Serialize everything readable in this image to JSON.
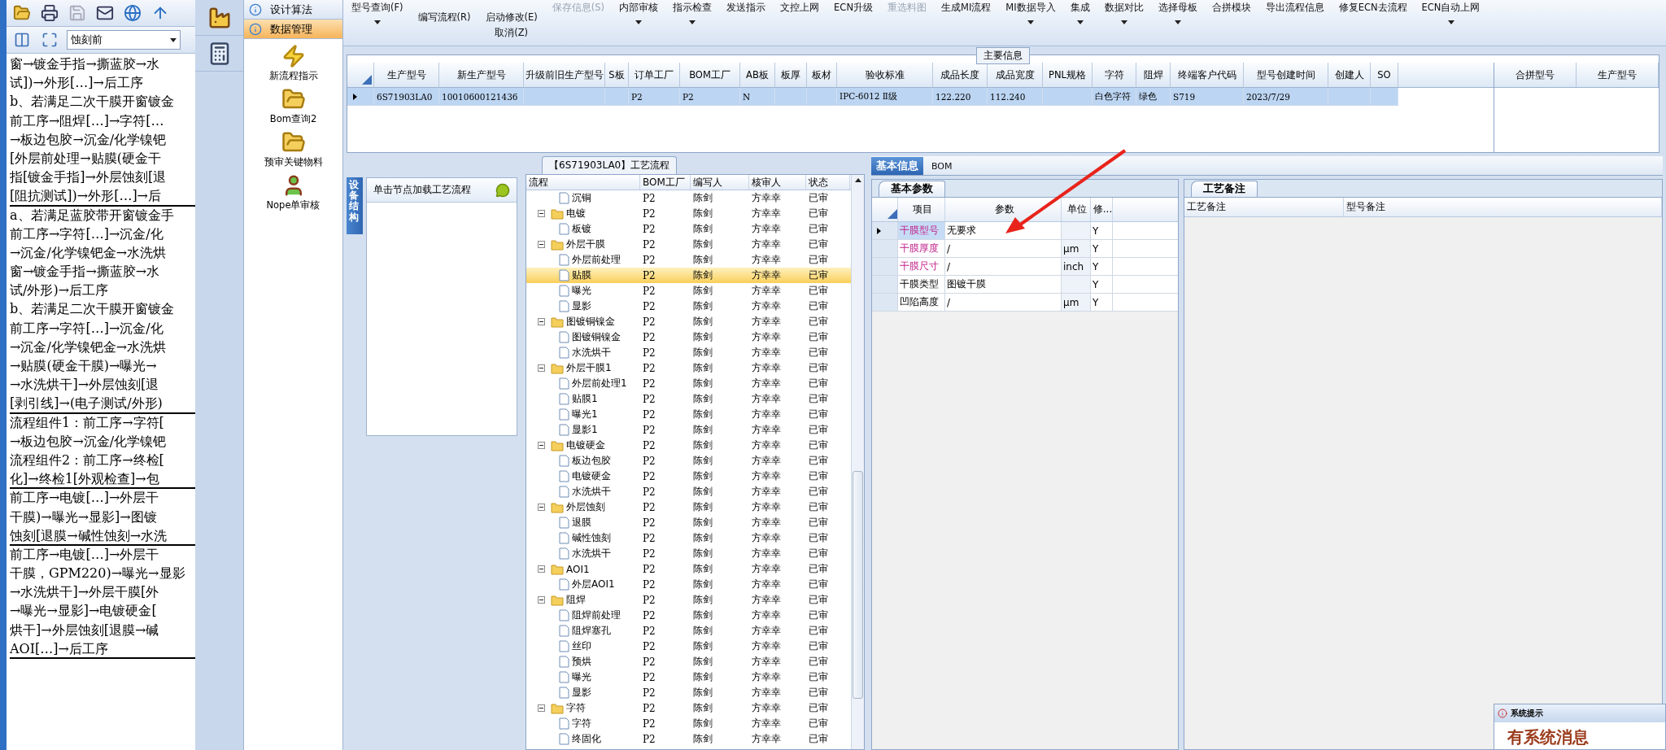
{
  "left_panel": {
    "combo_value": "蚀刻前",
    "lines": [
      {
        "text": "窗→镀金手指→撕蓝胶→水",
        "rule_below": false
      },
      {
        "text": "试])→外形[…]→后工序",
        "rule_below": false
      },
      {
        "text": "b、若满足二次干膜开窗镀金",
        "rule_below": false
      },
      {
        "text": "前工序→阻焊[…]→字符[…",
        "rule_below": false
      },
      {
        "text": "→板边包胶→沉金/化学镍钯",
        "rule_below": false
      },
      {
        "text": "[外层前处理→贴膜(硬金干",
        "rule_below": false
      },
      {
        "text": "指[镀金手指]→外层蚀刻[退",
        "rule_below": false
      },
      {
        "text": "[阻抗测试])→外形[…]→后",
        "rule_below": true
      },
      {
        "text": "a、若满足蓝胶带开窗镀金手",
        "rule_below": false
      },
      {
        "text": "前工序→字符[…]→沉金/化",
        "rule_below": false
      },
      {
        "text": "→沉金/化学镍钯金→水洗烘",
        "rule_below": false
      },
      {
        "text": "窗→镀金手指→撕蓝胶→水",
        "rule_below": false
      },
      {
        "text": "试/外形)→后工序",
        "rule_below": false
      },
      {
        "text": "b、若满足二次干膜开窗镀金",
        "rule_below": false
      },
      {
        "text": "前工序→字符[…]→沉金/化",
        "rule_below": false
      },
      {
        "text": "→沉金/化学镍钯金→水洗烘",
        "rule_below": false
      },
      {
        "text": "→贴膜(硬金干膜)→曝光→",
        "rule_below": false
      },
      {
        "text": "→水洗烘干]→外层蚀刻[退",
        "rule_below": false
      },
      {
        "text": "[剥引线]→(电子测试/外形)",
        "rule_below": true
      },
      {
        "text": "流程组件1：前工序→字符[",
        "rule_below": false
      },
      {
        "text": "→板边包胶→沉金/化学镍钯",
        "rule_below": false
      },
      {
        "text": "流程组件2：前工序→终检[",
        "rule_below": false
      },
      {
        "text": "化]→终检1[外观检查]→包",
        "rule_below": true
      },
      {
        "text": "前工序→电镀[…]→外层干",
        "rule_below": false
      },
      {
        "text": "干膜)→曝光→显影]→图镀",
        "rule_below": false
      },
      {
        "text": "蚀刻[退膜→碱性蚀刻→水洗",
        "rule_below": true
      },
      {
        "text": "前工序→电镀[…]→外层干",
        "rule_below": false
      },
      {
        "text": "干膜，GPM220)→曝光→显影",
        "rule_below": false
      },
      {
        "text": "→水洗烘干]→外层干膜[外",
        "rule_below": false
      },
      {
        "text": "→曝光→显影]→电镀硬金[",
        "rule_below": false
      },
      {
        "text": "烘干]→外层蚀刻[退膜→碱",
        "rule_below": false
      },
      {
        "text": "AOI[…]→后工序",
        "rule_below": true
      }
    ]
  },
  "nav": {
    "sections": [
      {
        "label": "设计算法",
        "selected": false
      },
      {
        "label": "数据管理",
        "selected": true
      }
    ],
    "items": [
      {
        "label": "新流程指示",
        "kind": "bolt"
      },
      {
        "label": "Bom查询2",
        "kind": "folder"
      },
      {
        "label": "预审关键物料",
        "kind": "folder"
      },
      {
        "label": "Nope单审核",
        "kind": "person"
      }
    ]
  },
  "toolbar": {
    "items": [
      {
        "label": "型号查询(F)",
        "menu": true,
        "disabled": false
      },
      {
        "stack": [
          {
            "label": "编写流程(R)",
            "disabled": false
          }
        ]
      },
      {
        "stack": [
          {
            "label": "启动修改(E)",
            "disabled": false
          },
          {
            "label": "取消(Z)",
            "disabled": false
          }
        ]
      },
      {
        "label": "保存信息(S)",
        "menu": false,
        "disabled": true
      },
      {
        "label": "内部审核",
        "menu": true,
        "disabled": false
      },
      {
        "label": "指示检查",
        "menu": true,
        "disabled": false
      },
      {
        "label": "发送指示",
        "menu": false,
        "disabled": false
      },
      {
        "label": "文控上网",
        "menu": false,
        "disabled": false
      },
      {
        "label": "ECN升级",
        "menu": false,
        "disabled": false
      },
      {
        "label": "重选料图",
        "menu": false,
        "disabled": true
      },
      {
        "label": "生成MI流程",
        "menu": false,
        "disabled": false
      },
      {
        "label": "MI数据导入",
        "menu": true,
        "disabled": false
      },
      {
        "label": "集成",
        "menu": true,
        "disabled": false
      },
      {
        "label": "数据对比",
        "menu": true,
        "disabled": false
      },
      {
        "label": "选择母板",
        "menu": true,
        "disabled": false
      },
      {
        "label": "合拼模块",
        "menu": false,
        "disabled": false
      },
      {
        "label": "导出流程信息",
        "menu": false,
        "disabled": false
      },
      {
        "label": "修复ECN去流程",
        "menu": false,
        "disabled": false
      },
      {
        "label": "ECN自动上网",
        "menu": true,
        "disabled": false
      }
    ]
  },
  "main_info": {
    "title": "主要信息",
    "columns": [
      "生产型号",
      "新生产型号",
      "升级前旧生产型号",
      "S板",
      "订单工厂",
      "BOM工厂",
      "AB板",
      "板厚",
      "板材",
      "验收标准",
      "成品长度",
      "成品宽度",
      "PNL规格",
      "字符",
      "阻焊",
      "终端客户代码",
      "型号创建时间",
      "创建人",
      "SO"
    ],
    "rows": [
      {
        "selected": true,
        "cells": {
          "0": "6S71903LA0",
          "1": "10010600121436",
          "4": "P2",
          "5": "P2",
          "6": "N",
          "9": "IPC-6012 Ⅱ级",
          "10": "122.220",
          "11": "112.240",
          "13": "白色字符",
          "14": "绿色",
          "15": "S719",
          "16": "2023/7/29"
        }
      }
    ],
    "side_columns": [
      "合拼型号",
      "生产型号"
    ]
  },
  "equipment_panel": {
    "tab": "设备结构",
    "hint": "单击节点加载工艺流程"
  },
  "process_tree": {
    "title": "【6S71903LA0】工艺流程",
    "columns": [
      "流程",
      "BOM工厂",
      "编写人",
      "核审人",
      "状态"
    ],
    "nodes": [
      {
        "kind": "file",
        "label": "沉铜",
        "bom": "P2",
        "writer": "陈剑",
        "reviewer": "方幸幸",
        "status": "已审",
        "selected": false
      },
      {
        "kind": "folder",
        "label": "电镀",
        "bom": "P2",
        "writer": "陈剑",
        "reviewer": "方幸幸",
        "status": "已审",
        "selected": false,
        "expanded": true,
        "children": [
          {
            "kind": "file",
            "label": "板镀",
            "bom": "P2",
            "writer": "陈剑",
            "reviewer": "方幸幸",
            "status": "已审",
            "selected": false
          }
        ]
      },
      {
        "kind": "folder",
        "label": "外层干膜",
        "bom": "P2",
        "writer": "陈剑",
        "reviewer": "方幸幸",
        "status": "已审",
        "selected": false,
        "expanded": true,
        "children": [
          {
            "kind": "file",
            "label": "外层前处理",
            "bom": "P2",
            "writer": "陈剑",
            "reviewer": "方幸幸",
            "status": "已审",
            "selected": false
          },
          {
            "kind": "file",
            "label": "贴膜",
            "bom": "P2",
            "writer": "陈剑",
            "reviewer": "方幸幸",
            "status": "已审",
            "selected": true
          },
          {
            "kind": "file",
            "label": "曝光",
            "bom": "P2",
            "writer": "陈剑",
            "reviewer": "方幸幸",
            "status": "已审",
            "selected": false
          },
          {
            "kind": "file",
            "label": "显影",
            "bom": "P2",
            "writer": "陈剑",
            "reviewer": "方幸幸",
            "status": "已审",
            "selected": false
          }
        ]
      },
      {
        "kind": "folder",
        "label": "图镀铜镍金",
        "bom": "P2",
        "writer": "陈剑",
        "reviewer": "方幸幸",
        "status": "已审",
        "selected": false,
        "expanded": true,
        "children": [
          {
            "kind": "file",
            "label": "图镀铜镍金",
            "bom": "P2",
            "writer": "陈剑",
            "reviewer": "方幸幸",
            "status": "已审",
            "selected": false
          },
          {
            "kind": "file",
            "label": "水洗烘干",
            "bom": "P2",
            "writer": "陈剑",
            "reviewer": "方幸幸",
            "status": "已审",
            "selected": false
          }
        ]
      },
      {
        "kind": "folder",
        "label": "外层干膜1",
        "bom": "P2",
        "writer": "陈剑",
        "reviewer": "方幸幸",
        "status": "已审",
        "selected": false,
        "expanded": true,
        "children": [
          {
            "kind": "file",
            "label": "外层前处理1",
            "bom": "P2",
            "writer": "陈剑",
            "reviewer": "方幸幸",
            "status": "已审",
            "selected": false
          },
          {
            "kind": "file",
            "label": "贴膜1",
            "bom": "P2",
            "writer": "陈剑",
            "reviewer": "方幸幸",
            "status": "已审",
            "selected": false
          },
          {
            "kind": "file",
            "label": "曝光1",
            "bom": "P2",
            "writer": "陈剑",
            "reviewer": "方幸幸",
            "status": "已审",
            "selected": false
          },
          {
            "kind": "file",
            "label": "显影1",
            "bom": "P2",
            "writer": "陈剑",
            "reviewer": "方幸幸",
            "status": "已审",
            "selected": false
          }
        ]
      },
      {
        "kind": "folder",
        "label": "电镀硬金",
        "bom": "P2",
        "writer": "陈剑",
        "reviewer": "方幸幸",
        "status": "已审",
        "selected": false,
        "expanded": true,
        "children": [
          {
            "kind": "file",
            "label": "板边包胶",
            "bom": "P2",
            "writer": "陈剑",
            "reviewer": "方幸幸",
            "status": "已审",
            "selected": false
          },
          {
            "kind": "file",
            "label": "电镀硬金",
            "bom": "P2",
            "writer": "陈剑",
            "reviewer": "方幸幸",
            "status": "已审",
            "selected": false
          },
          {
            "kind": "file",
            "label": "水洗烘干",
            "bom": "P2",
            "writer": "陈剑",
            "reviewer": "方幸幸",
            "status": "已审",
            "selected": false
          }
        ]
      },
      {
        "kind": "folder",
        "label": "外层蚀刻",
        "bom": "P2",
        "writer": "陈剑",
        "reviewer": "方幸幸",
        "status": "已审",
        "selected": false,
        "expanded": true,
        "children": [
          {
            "kind": "file",
            "label": "退膜",
            "bom": "P2",
            "writer": "陈剑",
            "reviewer": "方幸幸",
            "status": "已审",
            "selected": false
          },
          {
            "kind": "file",
            "label": "碱性蚀刻",
            "bom": "P2",
            "writer": "陈剑",
            "reviewer": "方幸幸",
            "status": "已审",
            "selected": false
          },
          {
            "kind": "file",
            "label": "水洗烘干",
            "bom": "P2",
            "writer": "陈剑",
            "reviewer": "方幸幸",
            "status": "已审",
            "selected": false
          }
        ]
      },
      {
        "kind": "folder",
        "label": "AOI1",
        "bom": "P2",
        "writer": "陈剑",
        "reviewer": "方幸幸",
        "status": "已审",
        "selected": false,
        "expanded": true,
        "children": [
          {
            "kind": "file",
            "label": "外层AOI1",
            "bom": "P2",
            "writer": "陈剑",
            "reviewer": "方幸幸",
            "status": "已审",
            "selected": false
          }
        ]
      },
      {
        "kind": "folder",
        "label": "阻焊",
        "bom": "P2",
        "writer": "陈剑",
        "reviewer": "方幸幸",
        "status": "已审",
        "selected": false,
        "expanded": true,
        "children": [
          {
            "kind": "file",
            "label": "阻焊前处理",
            "bom": "P2",
            "writer": "陈剑",
            "reviewer": "方幸幸",
            "status": "已审",
            "selected": false
          },
          {
            "kind": "file",
            "label": "阻焊塞孔",
            "bom": "P2",
            "writer": "陈剑",
            "reviewer": "方幸幸",
            "status": "已审",
            "selected": false
          },
          {
            "kind": "file",
            "label": "丝印",
            "bom": "P2",
            "writer": "陈剑",
            "reviewer": "方幸幸",
            "status": "已审",
            "selected": false
          },
          {
            "kind": "file",
            "label": "预烘",
            "bom": "P2",
            "writer": "陈剑",
            "reviewer": "方幸幸",
            "status": "已审",
            "selected": false
          },
          {
            "kind": "file",
            "label": "曝光",
            "bom": "P2",
            "writer": "陈剑",
            "reviewer": "方幸幸",
            "status": "已审",
            "selected": false
          },
          {
            "kind": "file",
            "label": "显影",
            "bom": "P2",
            "writer": "陈剑",
            "reviewer": "方幸幸",
            "status": "已审",
            "selected": false
          }
        ]
      },
      {
        "kind": "folder",
        "label": "字符",
        "bom": "P2",
        "writer": "陈剑",
        "reviewer": "方幸幸",
        "status": "已审",
        "selected": false,
        "expanded": true,
        "children": [
          {
            "kind": "file",
            "label": "字符",
            "bom": "P2",
            "writer": "陈剑",
            "reviewer": "方幸幸",
            "status": "已审",
            "selected": false
          },
          {
            "kind": "file",
            "label": "终固化",
            "bom": "P2",
            "writer": "陈剑",
            "reviewer": "方幸幸",
            "status": "已审",
            "selected": false
          }
        ]
      }
    ]
  },
  "detail": {
    "tabs": [
      {
        "label": "基本信息",
        "selected": true
      },
      {
        "label": "BOM",
        "selected": false
      }
    ],
    "params": {
      "tab": "基本参数",
      "columns": [
        "项目",
        "参数",
        "单位",
        "修..."
      ],
      "rows": [
        {
          "item": "干膜型号",
          "value": "无要求",
          "flag": "Y",
          "highlighted": true,
          "selected": true
        },
        {
          "item": "干膜厚度",
          "value": "/",
          "unit": "μm",
          "flag": "Y",
          "highlighted": true,
          "selected": false
        },
        {
          "item": "干膜尺寸",
          "value": "/",
          "unit": "inch",
          "flag": "Y",
          "highlighted": true,
          "selected": false
        },
        {
          "item": "干膜类型",
          "value": "图镀干膜",
          "flag": "Y",
          "highlighted": false,
          "selected": false
        },
        {
          "item": "凹陷高度",
          "value": "/",
          "unit": "μm",
          "flag": "Y",
          "highlighted": false,
          "selected": false
        }
      ]
    },
    "remarks": {
      "tab": "工艺备注",
      "columns": [
        "工艺备注",
        "型号备注"
      ]
    }
  },
  "system_tip": {
    "title": "系统提示",
    "message": "有系统消息"
  }
}
